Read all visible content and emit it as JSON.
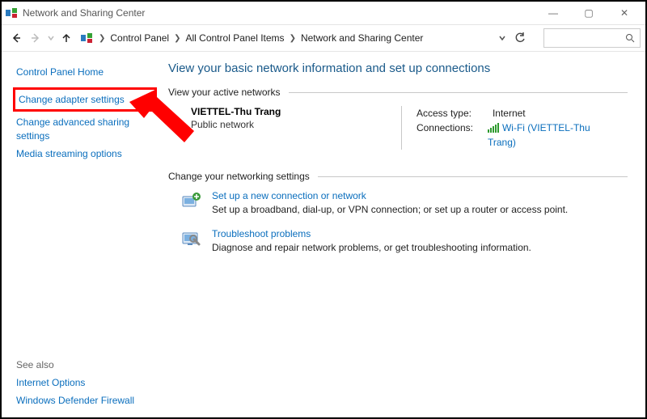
{
  "window": {
    "title": "Network and Sharing Center",
    "min": "—",
    "max": "▢",
    "close": "✕"
  },
  "toolbar": {
    "breadcrumbs": [
      "Control Panel",
      "All Control Panel Items",
      "Network and Sharing Center"
    ],
    "search_placeholder": ""
  },
  "sidebar": {
    "home": "Control Panel Home",
    "items": [
      "Change adapter settings",
      "Change advanced sharing settings",
      "Media streaming options"
    ],
    "see_also_label": "See also",
    "see_also": [
      "Internet Options",
      "Windows Defender Firewall"
    ]
  },
  "main": {
    "title": "View your basic network information and set up connections",
    "active_heading": "View your active networks",
    "network": {
      "name": "VIETTEL-Thu Trang",
      "type": "Public network",
      "access_label": "Access type:",
      "access_value": "Internet",
      "conn_label": "Connections:",
      "conn_value": "Wi-Fi (VIETTEL-Thu Trang)"
    },
    "change_heading": "Change your networking settings",
    "settings": [
      {
        "title": "Set up a new connection or network",
        "desc": "Set up a broadband, dial-up, or VPN connection; or set up a router or access point."
      },
      {
        "title": "Troubleshoot problems",
        "desc": "Diagnose and repair network problems, or get troubleshooting information."
      }
    ]
  }
}
